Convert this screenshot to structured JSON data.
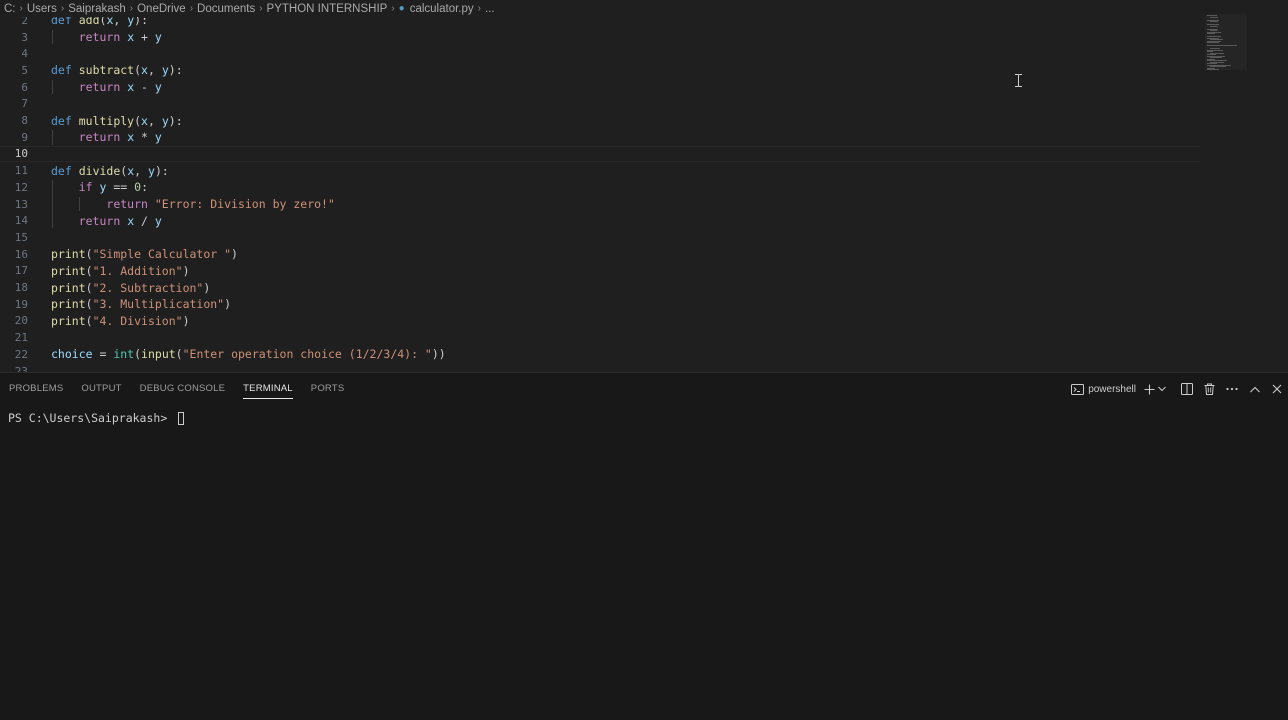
{
  "breadcrumb": {
    "items": [
      "C:",
      "Users",
      "Saiprakash",
      "OneDrive",
      "Documents",
      "PYTHON INTERNSHIP"
    ],
    "file": "calculator.py",
    "more": "..."
  },
  "editor": {
    "current_line": "10",
    "lines": [
      {
        "n": "2",
        "tokens": [
          [
            "kw",
            "def"
          ],
          [
            "p",
            " "
          ],
          [
            "fn",
            "add"
          ],
          [
            "p",
            "("
          ],
          [
            "prm",
            "x"
          ],
          [
            "p",
            ", "
          ],
          [
            "prm",
            "y"
          ],
          [
            "p",
            "):"
          ]
        ]
      },
      {
        "n": "3",
        "tokens": [
          [
            "p",
            "    "
          ],
          [
            "kw2",
            "return"
          ],
          [
            "p",
            " "
          ],
          [
            "prm",
            "x"
          ],
          [
            "p",
            " + "
          ],
          [
            "prm",
            "y"
          ]
        ]
      },
      {
        "n": "4",
        "tokens": []
      },
      {
        "n": "5",
        "tokens": [
          [
            "kw",
            "def"
          ],
          [
            "p",
            " "
          ],
          [
            "fn",
            "subtract"
          ],
          [
            "p",
            "("
          ],
          [
            "prm",
            "x"
          ],
          [
            "p",
            ", "
          ],
          [
            "prm",
            "y"
          ],
          [
            "p",
            "):"
          ]
        ]
      },
      {
        "n": "6",
        "tokens": [
          [
            "p",
            "    "
          ],
          [
            "kw2",
            "return"
          ],
          [
            "p",
            " "
          ],
          [
            "prm",
            "x"
          ],
          [
            "p",
            " - "
          ],
          [
            "prm",
            "y"
          ]
        ]
      },
      {
        "n": "7",
        "tokens": []
      },
      {
        "n": "8",
        "tokens": [
          [
            "kw",
            "def"
          ],
          [
            "p",
            " "
          ],
          [
            "fn",
            "multiply"
          ],
          [
            "p",
            "("
          ],
          [
            "prm",
            "x"
          ],
          [
            "p",
            ", "
          ],
          [
            "prm",
            "y"
          ],
          [
            "p",
            "):"
          ]
        ]
      },
      {
        "n": "9",
        "tokens": [
          [
            "p",
            "    "
          ],
          [
            "kw2",
            "return"
          ],
          [
            "p",
            " "
          ],
          [
            "prm",
            "x"
          ],
          [
            "p",
            " * "
          ],
          [
            "prm",
            "y"
          ]
        ]
      },
      {
        "n": "10",
        "tokens": []
      },
      {
        "n": "11",
        "tokens": [
          [
            "kw",
            "def"
          ],
          [
            "p",
            " "
          ],
          [
            "fn",
            "divide"
          ],
          [
            "p",
            "("
          ],
          [
            "prm",
            "x"
          ],
          [
            "p",
            ", "
          ],
          [
            "prm",
            "y"
          ],
          [
            "p",
            "):"
          ]
        ]
      },
      {
        "n": "12",
        "tokens": [
          [
            "p",
            "    "
          ],
          [
            "kw2",
            "if"
          ],
          [
            "p",
            " "
          ],
          [
            "prm",
            "y"
          ],
          [
            "p",
            " == "
          ],
          [
            "num",
            "0"
          ],
          [
            "p",
            ":"
          ]
        ]
      },
      {
        "n": "13",
        "tokens": [
          [
            "p",
            "        "
          ],
          [
            "kw2",
            "return"
          ],
          [
            "p",
            " "
          ],
          [
            "str",
            "\"Error: Division by zero!\""
          ]
        ]
      },
      {
        "n": "14",
        "tokens": [
          [
            "p",
            "    "
          ],
          [
            "kw2",
            "return"
          ],
          [
            "p",
            " "
          ],
          [
            "prm",
            "x"
          ],
          [
            "p",
            " / "
          ],
          [
            "prm",
            "y"
          ]
        ]
      },
      {
        "n": "15",
        "tokens": []
      },
      {
        "n": "16",
        "tokens": [
          [
            "fn",
            "print"
          ],
          [
            "p",
            "("
          ],
          [
            "str",
            "\"Simple Calculator \""
          ],
          [
            "p",
            ")"
          ]
        ]
      },
      {
        "n": "17",
        "tokens": [
          [
            "fn",
            "print"
          ],
          [
            "p",
            "("
          ],
          [
            "str",
            "\"1. Addition\""
          ],
          [
            "p",
            ")"
          ]
        ]
      },
      {
        "n": "18",
        "tokens": [
          [
            "fn",
            "print"
          ],
          [
            "p",
            "("
          ],
          [
            "str",
            "\"2. Subtraction\""
          ],
          [
            "p",
            ")"
          ]
        ]
      },
      {
        "n": "19",
        "tokens": [
          [
            "fn",
            "print"
          ],
          [
            "p",
            "("
          ],
          [
            "str",
            "\"3. Multiplication\""
          ],
          [
            "p",
            ")"
          ]
        ]
      },
      {
        "n": "20",
        "tokens": [
          [
            "fn",
            "print"
          ],
          [
            "p",
            "("
          ],
          [
            "str",
            "\"4. Division\""
          ],
          [
            "p",
            ")"
          ]
        ]
      },
      {
        "n": "21",
        "tokens": []
      },
      {
        "n": "22",
        "tokens": [
          [
            "prm",
            "choice"
          ],
          [
            "p",
            " = "
          ],
          [
            "cls",
            "int"
          ],
          [
            "p",
            "("
          ],
          [
            "fn",
            "input"
          ],
          [
            "p",
            "("
          ],
          [
            "str",
            "\"Enter operation choice (1/2/3/4): \""
          ],
          [
            "p",
            "))"
          ]
        ]
      },
      {
        "n": "23",
        "tokens": []
      }
    ]
  },
  "panel": {
    "tabs": [
      {
        "label": "PROBLEMS",
        "active": false
      },
      {
        "label": "OUTPUT",
        "active": false
      },
      {
        "label": "DEBUG CONSOLE",
        "active": false
      },
      {
        "label": "TERMINAL",
        "active": true
      },
      {
        "label": "PORTS",
        "active": false
      }
    ],
    "shell_label": "powershell",
    "icons": [
      "terminal-icon",
      "plus-icon",
      "chevron-down-icon",
      "split-icon",
      "trash-icon",
      "ellipsis-icon",
      "chevron-up-icon",
      "close-icon"
    ]
  },
  "terminal": {
    "prompt": "PS C:\\Users\\Saiprakash> "
  },
  "colors": {
    "keyword": "#569cd6",
    "control": "#c586c0",
    "function": "#dcdcaa",
    "parameter": "#9cdcfe",
    "string": "#ce9178",
    "number": "#b5cea8",
    "class": "#4ec9b0"
  }
}
